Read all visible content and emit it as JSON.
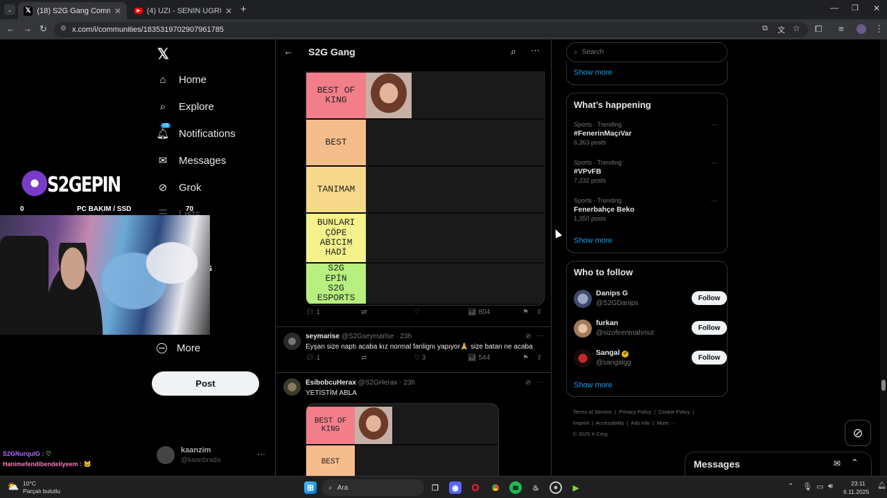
{
  "browser": {
    "tabs": [
      {
        "title": "(18) S2G Gang Community / X",
        "active": true
      },
      {
        "title": "(4) UZI - SENIN UGRUNA FT MA",
        "active": false
      }
    ],
    "url": "x.com/i/communities/1835319702907961785"
  },
  "overlay": {
    "brand": "S2GEPIN",
    "counter_left": "0",
    "label": "PC BAKIM / SSD",
    "counter_right": "70",
    "chat": [
      {
        "user": "S2GNurqulG :",
        "emoji": "♡"
      },
      {
        "user": "Hanimefendibendeliyeem :",
        "emoji": "🐱"
      }
    ]
  },
  "nav": {
    "items": [
      {
        "label": "Home",
        "icon": "home-icon"
      },
      {
        "label": "Explore",
        "icon": "search-icon"
      },
      {
        "label": "Notifications",
        "icon": "bell-icon",
        "badge": "18"
      },
      {
        "label": "Messages",
        "icon": "mail-icon"
      },
      {
        "label": "Grok",
        "icon": "grok-icon"
      },
      {
        "label": "Lists",
        "icon": "list-icon"
      },
      {
        "label": "arks",
        "icon": "bookmark-icon"
      },
      {
        "label": "unities",
        "icon": "communities-icon"
      },
      {
        "label": "m",
        "icon": "premium-icon"
      },
      {
        "label": "More",
        "icon": "more-circle-icon"
      }
    ],
    "post": "Post",
    "account": {
      "name": "kaanzim",
      "handle": "@kaanbrada"
    }
  },
  "header": {
    "title": "S2G Gang"
  },
  "tierlist": {
    "rows": [
      {
        "label": "BEST OF KING",
        "color": "#f27e8a"
      },
      {
        "label": "BEST",
        "color": "#f5bd8c"
      },
      {
        "label": "TANIMAM",
        "color": "#f6d98a"
      },
      {
        "label": "BUNLARI ÇÖPE ABICIM HADİ",
        "color": "#f5f28b"
      },
      {
        "label": "S2G EPİN S2G ESPORTS",
        "color": "#b7f07e"
      }
    ]
  },
  "post1_actions": {
    "replies": "1",
    "views": "804"
  },
  "post2": {
    "name": "seymarise",
    "handle": "@S2Gseymarlse",
    "time": "· 23h",
    "text": "Eyşan size naptı acaba kız normal fanlignı yapıyor🙏 size batan ne acaba",
    "replies": "1",
    "likes": "3",
    "views": "544"
  },
  "post3": {
    "name": "EsibobcuHerax",
    "handle": "@S2GHerax",
    "time": "· 23h",
    "text": "YETİSTİM ABLA",
    "tiers": [
      {
        "label": "BEST OF KING",
        "color": "#f27e8a"
      },
      {
        "label": "BEST",
        "color": "#f5bd8c"
      }
    ]
  },
  "sidebar": {
    "search_placeholder": "Search",
    "show_more": "Show more",
    "happening": {
      "title": "What’s happening",
      "trends": [
        {
          "meta": "Sports · Trending",
          "name": "#FenerinMaçıVar",
          "posts": "6,363 posts"
        },
        {
          "meta": "Sports · Trending",
          "name": "#VPvFB",
          "posts": "7,232 posts"
        },
        {
          "meta": "Sports · Trending",
          "name": "Fenerbahçe Beko",
          "posts": "1,350 posts"
        }
      ]
    },
    "who_to_follow": {
      "title": "Who to follow",
      "users": [
        {
          "name": "Danips G",
          "handle": "@S2GDanips",
          "button": "Follow"
        },
        {
          "name": "furkan",
          "handle": "@sizofirenmahmut",
          "button": "Follow"
        },
        {
          "name": "Sangal",
          "handle": "@sangalgg",
          "button": "Follow"
        }
      ]
    },
    "footer": {
      "line1": [
        "Terms of Service",
        "Privacy Policy",
        "Cookie Policy"
      ],
      "line2": [
        "Imprint",
        "Accessibility",
        "Ads info",
        "More ···"
      ],
      "copyright": "© 2025 X Corp."
    },
    "messages": "Messages"
  },
  "taskbar": {
    "weather_temp": "10°C",
    "weather_desc": "Parçalı bulutlu",
    "search": "Ara",
    "time": "23:11",
    "date": "6.11.2025"
  }
}
